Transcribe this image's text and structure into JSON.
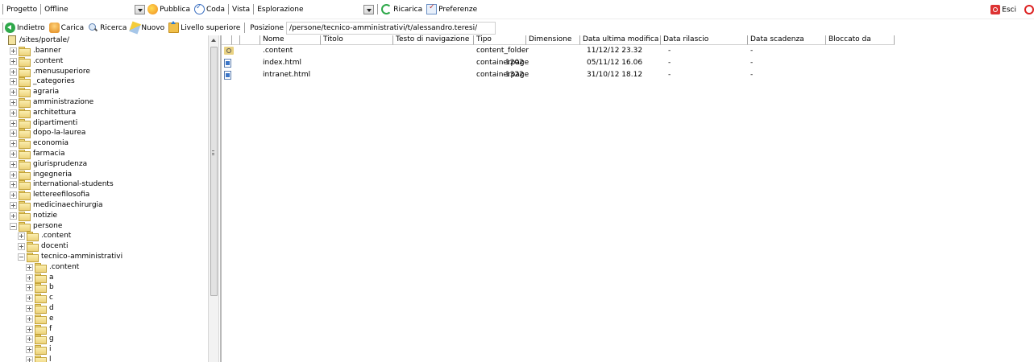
{
  "toolbar1": {
    "project_label": "Progetto",
    "project_value": "Offline",
    "publish_label": "Pubblica",
    "queue_label": "Coda",
    "view_label": "Vista",
    "view_value": "Esplorazione",
    "reload_label": "Ricarica",
    "prefs_label": "Preferenze",
    "exit_label": "Esci"
  },
  "toolbar2": {
    "back_label": "Indietro",
    "upload_label": "Carica",
    "search_label": "Ricerca",
    "new_label": "Nuovo",
    "up_label": "Livello superiore",
    "position_label": "Posizione",
    "position_value": "/persone/tecnico-amministrativi/t/alessandro.teresi/"
  },
  "tree": {
    "root": "/sites/portale/",
    "items": [
      {
        "label": ".banner"
      },
      {
        "label": ".content"
      },
      {
        "label": ".menusuperiore"
      },
      {
        "label": "_categories"
      },
      {
        "label": "agraria"
      },
      {
        "label": "amministrazione"
      },
      {
        "label": "architettura"
      },
      {
        "label": "dipartimenti"
      },
      {
        "label": "dopo-la-laurea"
      },
      {
        "label": "economia"
      },
      {
        "label": "farmacia"
      },
      {
        "label": "giurisprudenza"
      },
      {
        "label": "ingegneria"
      },
      {
        "label": "international-students"
      },
      {
        "label": "lettereefilosofia"
      },
      {
        "label": "medicinaechirurgia"
      },
      {
        "label": "notizie"
      },
      {
        "label": "persone",
        "expanded": true
      },
      {
        "label": ".content"
      },
      {
        "label": "docenti"
      },
      {
        "label": "tecnico-amministrativi",
        "expanded": true
      },
      {
        "label": ".content"
      },
      {
        "label": "a"
      },
      {
        "label": "b"
      },
      {
        "label": "c"
      },
      {
        "label": "d"
      },
      {
        "label": "e"
      },
      {
        "label": "f"
      },
      {
        "label": "g"
      },
      {
        "label": "i"
      },
      {
        "label": "l"
      }
    ]
  },
  "filelist": {
    "columns": [
      "Nome",
      "Titolo",
      "Testo di navigazione",
      "Tipo",
      "Dimensione",
      "Data ultima modifica",
      "Data rilascio",
      "Data scadenza",
      "Bloccato da"
    ],
    "rows": [
      {
        "icon": "folder-link-icon",
        "name": ".content",
        "title": "",
        "nav": "",
        "type": "content_folder",
        "size": "",
        "modified": "11/12/12 23.32",
        "release": "-",
        "expire": "-",
        "locked": ""
      },
      {
        "icon": "page-icon",
        "name": "index.html",
        "title": "",
        "nav": "",
        "type": "containerpage",
        "size": "1202",
        "modified": "05/11/12 16.06",
        "release": "-",
        "expire": "-",
        "locked": ""
      },
      {
        "icon": "page-icon",
        "name": "intranet.html",
        "title": "",
        "nav": "",
        "type": "containerpage",
        "size": "1322",
        "modified": "31/10/12 18.12",
        "release": "-",
        "expire": "-",
        "locked": ""
      }
    ]
  }
}
